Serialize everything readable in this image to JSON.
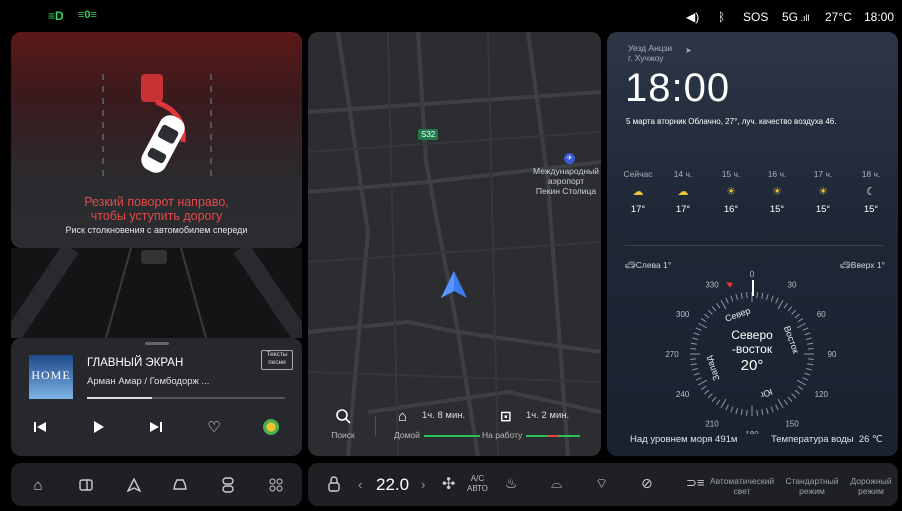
{
  "status_bar": {
    "headlight_icon": "low-beam-icon",
    "foglight_icon": "fog-light-icon",
    "volume_icon": "speaker-icon",
    "bluetooth_icon": "bluetooth-icon",
    "sos": "SOS",
    "network": "5G",
    "temperature": "27°C",
    "time": "18:00"
  },
  "alert": {
    "title_line1": "Резкий поворот направо,",
    "title_line2": "чтобы уступить дорогу",
    "subtitle": "Риск столкновения с автомобилем спереди",
    "accent": "#e0373a"
  },
  "music": {
    "album_text": "HOME",
    "title": "ГЛАВНЫЙ ЭКРАН",
    "lyrics_button": "Тексты\nпесни",
    "artist": "Арман Амар / Гомбодорж ...",
    "progress": 0.33
  },
  "map": {
    "road_badge": "S32",
    "poi_line1": "Международный",
    "poi_line2": "аэропорт",
    "poi_line3": "Пекин Столица",
    "search_label": "Поиск",
    "home_time": "1ч. 8 мин.",
    "home_label": "Домой",
    "work_time": "1ч. 2 мин.",
    "work_label": "На работу"
  },
  "weather": {
    "location_line1": "Уезд Анцзи",
    "location_line2": "г. Хучжоу",
    "time": "18:00",
    "summary": "5 марта вторник Облачно, 27°, луч. качество воздуха 46.",
    "hourly": [
      {
        "label": "Сейчас",
        "icon": "cloudy-icon",
        "temp": "17°"
      },
      {
        "label": "14 ч.",
        "icon": "cloudy-icon",
        "temp": "17°"
      },
      {
        "label": "15 ч.",
        "icon": "sun-icon",
        "temp": "16°"
      },
      {
        "label": "16 ч.",
        "icon": "sun-icon",
        "temp": "15°"
      },
      {
        "label": "17 ч.",
        "icon": "sun-icon",
        "temp": "15°"
      },
      {
        "label": "18 ч.",
        "icon": "moon-icon",
        "temp": "15°"
      }
    ],
    "tilt_left": "Слева 1°",
    "tilt_up": "Вверх 1°",
    "compass": {
      "heading_line1": "Северо",
      "heading_line2": "-восток",
      "heading_deg": "20°",
      "north": "Север",
      "east": "Восток",
      "south": "Юг",
      "west": "Запад",
      "ticks": [
        "0",
        "30",
        "60",
        "90",
        "120",
        "150",
        "180",
        "210",
        "240",
        "270",
        "300",
        "330"
      ]
    },
    "altitude": "Над уровнем моря 491м",
    "water_temp": "Температура воды  26 ℃"
  },
  "dock": {
    "ac_temp": "22.0",
    "ac_label_top": "A/C",
    "ac_label_bottom": "АВТО",
    "auto_light_line1": "Автоматический",
    "auto_light_line2": "свет",
    "standard_line1": "Стандартный",
    "standard_line2": "режим",
    "road_line1": "Дорожный",
    "road_line2": "режим"
  }
}
